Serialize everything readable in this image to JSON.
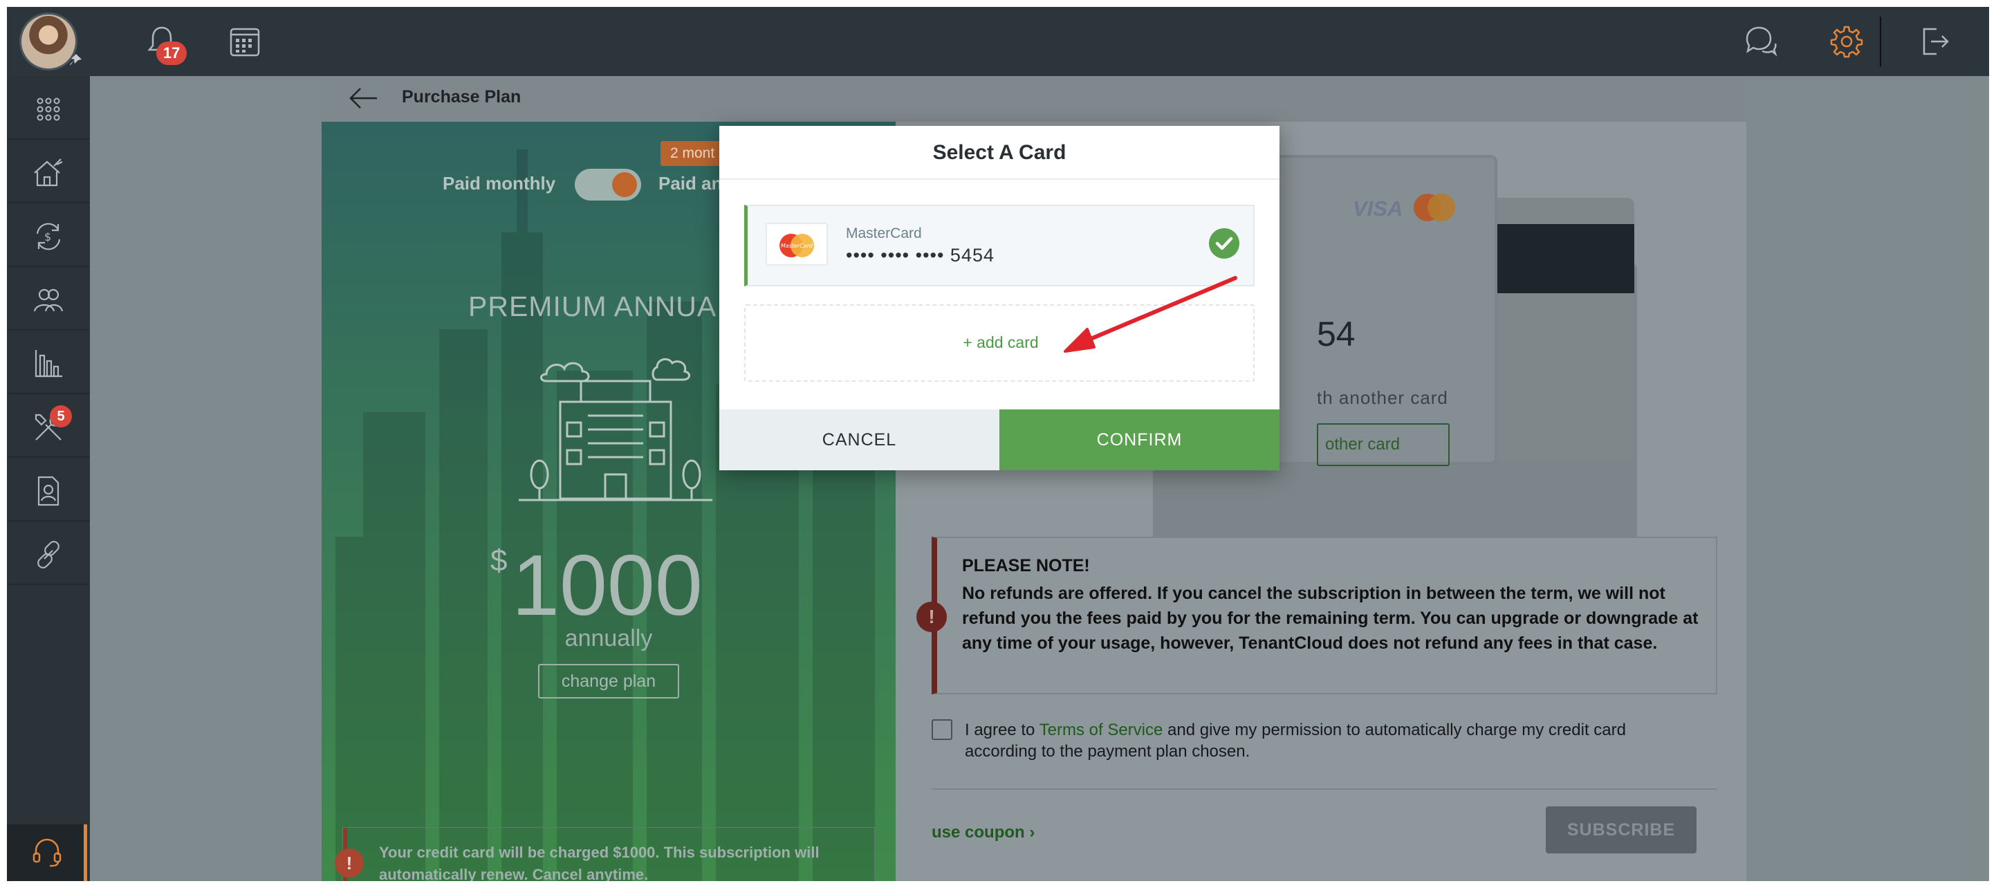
{
  "topbar": {
    "notification_count": "17",
    "icons": [
      "avatar",
      "bell-icon",
      "calendar-icon",
      "chat-icon",
      "gear-icon",
      "logout-icon"
    ]
  },
  "sidebar": {
    "items": [
      "apps-grid-icon",
      "properties-icon",
      "transactions-icon",
      "tenants-icon",
      "reports-icon",
      "maintenance-icon",
      "applications-icon",
      "integrations-icon"
    ],
    "maintenance_badge": "5",
    "support_icon": "headset-icon"
  },
  "page": {
    "title": "Purchase Plan",
    "billing": {
      "monthly_label": "Paid monthly",
      "annually_label": "Paid an",
      "discount_badge": "2 mont"
    },
    "plan": {
      "name": "PREMIUM ANNUA",
      "currency": "$",
      "price": "1000",
      "period": "annually",
      "change_label": "change plan",
      "charge_note": "Your credit card will be charged $1000. This subscription will automatically renew. Cancel anytime."
    },
    "payment": {
      "visa_label": "VISA",
      "card_number_end": "54",
      "pay_with_text": "th another card",
      "add_another_label": "other card",
      "note_title": "PLEASE NOTE!",
      "note_body": "No refunds are offered. If you cancel the subscription in between the term, we will not refund you the fees paid by you for the remaining term. You can upgrade or downgrade at any time of your usage, however, TenantCloud does not refund any fees in that case.",
      "agree_prefix": "I agree to ",
      "agree_link": "Terms of Service",
      "agree_suffix": " and give my permission to automatically charge my credit card according to the payment plan chosen.",
      "coupon_label": "use coupon ›",
      "subscribe_label": "SUBSCRIBE"
    }
  },
  "modal": {
    "title": "Select A Card",
    "card": {
      "brand": "MasterCard",
      "number": "•••• •••• •••• 5454",
      "logo_text": "MasterCard"
    },
    "add_card_label": "+ add card",
    "cancel_label": "CANCEL",
    "confirm_label": "CONFIRM"
  },
  "colors": {
    "accent_green": "#5aa24f",
    "topbar": "#2c353b",
    "badge_red": "#d8453a",
    "annotation_red": "#e0242b"
  }
}
